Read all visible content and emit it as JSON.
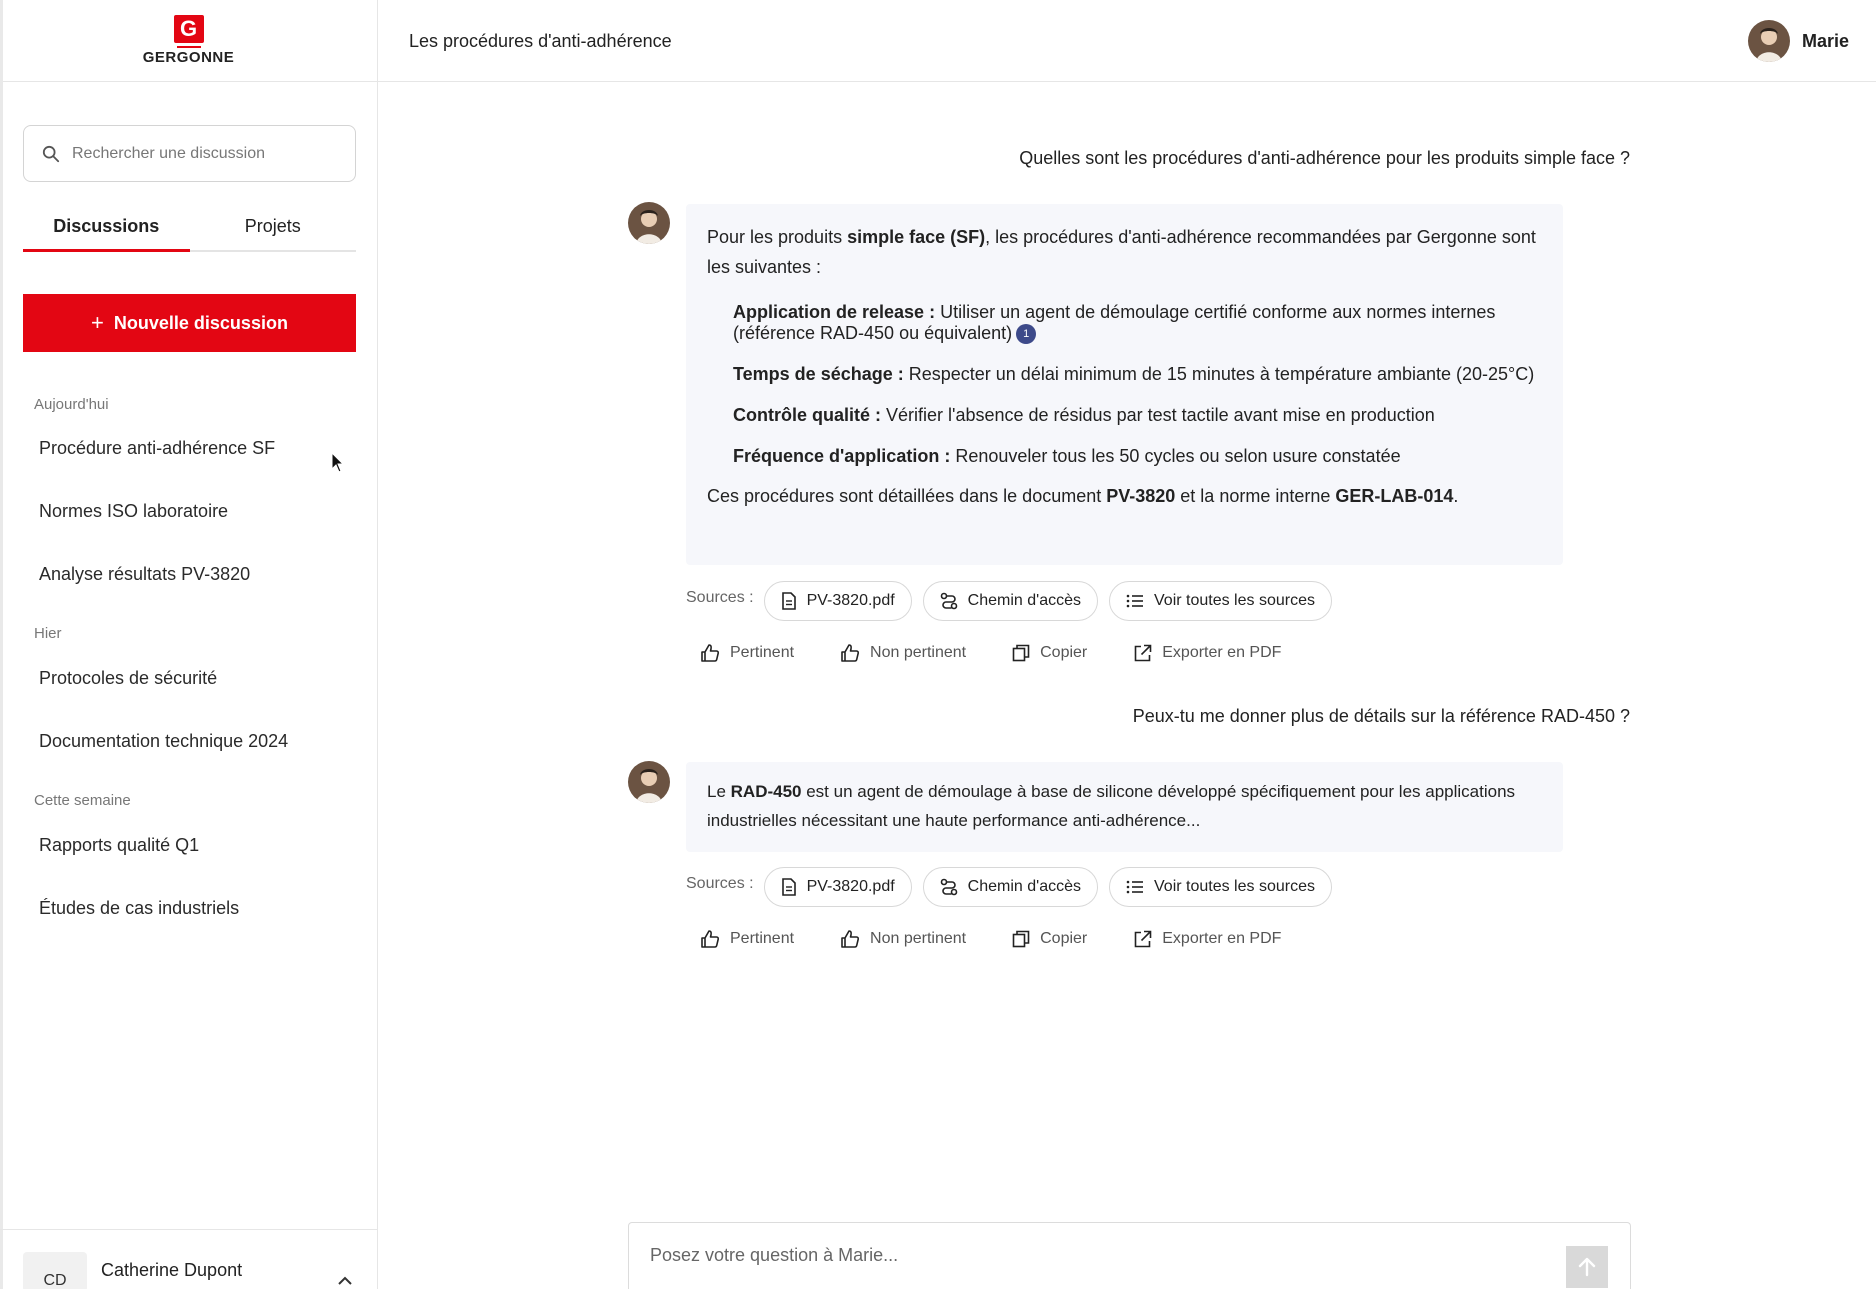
{
  "brand": {
    "logo_letter": "G",
    "name": "GERGONNE",
    "accent": "#e30613"
  },
  "sidebar": {
    "search_placeholder": "Rechercher une discussion",
    "tabs": [
      {
        "label": "Discussions",
        "active": true
      },
      {
        "label": "Projets",
        "active": false
      }
    ],
    "new_button": {
      "icon": "+",
      "label": "Nouvelle discussion"
    },
    "sections": [
      {
        "label": "Aujourd'hui",
        "items": [
          "Procédure anti-adhérence SF",
          "Normes ISO laboratoire",
          "Analyse résultats PV-3820"
        ]
      },
      {
        "label": "Hier",
        "items": [
          "Protocoles de sécurité",
          "Documentation technique 2024"
        ]
      },
      {
        "label": "Cette semaine",
        "items": [
          "Rapports qualité Q1",
          "Études de cas industriels"
        ]
      }
    ],
    "user": {
      "initials": "CD",
      "name": "Catherine Dupont"
    }
  },
  "header": {
    "title": "Les procédures d'anti-adhérence",
    "assistant_name": "Marie"
  },
  "chat": {
    "messages": [
      {
        "role": "user",
        "text": "Quelles sont les procédures d'anti-adhérence pour les produits simple face ?"
      },
      {
        "role": "assistant",
        "intro_prefix": "Pour les produits ",
        "intro_bold": "simple face (SF)",
        "intro_suffix": ", les procédures d'anti-adhérence recommandées par Gergonne sont les suivantes :",
        "procedures": [
          {
            "title": "Application de release :",
            "text": "Utiliser un agent de démoulage certifié conforme aux normes internes (référence RAD-450 ou équivalent)",
            "citation": "1"
          },
          {
            "title": "Temps de séchage :",
            "text": "Respecter un délai minimum de 15 minutes à température ambiante (20-25°C)"
          },
          {
            "title": "Contrôle qualité :",
            "text": "Vérifier l'absence de résidus par test tactile avant mise en production"
          },
          {
            "title": "Fréquence d'application :",
            "text": "Renouveler tous les 50 cycles ou selon usure constatée"
          }
        ],
        "outro_prefix": "Ces procédures sont détaillées dans le document ",
        "outro_doc": "PV-3820",
        "outro_mid": " et la norme interne ",
        "outro_norm": "GER-LAB-014",
        "outro_end": "."
      },
      {
        "role": "user",
        "text": "Peux-tu me donner plus de détails sur la référence RAD-450 ?"
      },
      {
        "role": "assistant",
        "prefix": "Le ",
        "bold": "RAD-450",
        "suffix": " est un agent de démoulage à base de silicone développé spécifiquement pour les applications industrielles nécessitant une haute performance anti-adhérence..."
      }
    ],
    "sources": {
      "label": "Sources :",
      "chips": [
        {
          "icon": "document-icon",
          "label": "PV-3820.pdf"
        },
        {
          "icon": "route-icon",
          "label": "Chemin d'accès"
        },
        {
          "icon": "list-icon",
          "label": "Voir toutes les sources"
        }
      ]
    },
    "actions": [
      {
        "icon": "thumbs-up-icon",
        "label": "Pertinent"
      },
      {
        "icon": "thumbs-down-icon",
        "label": "Non pertinent"
      },
      {
        "icon": "copy-icon",
        "label": "Copier"
      },
      {
        "icon": "export-icon",
        "label": "Exporter en PDF"
      }
    ]
  },
  "composer": {
    "placeholder": "Posez votre question à Marie..."
  }
}
